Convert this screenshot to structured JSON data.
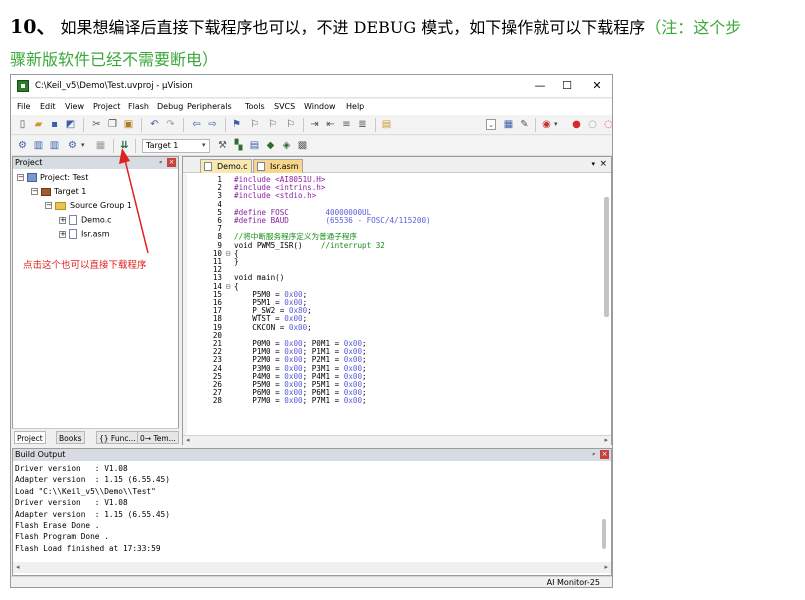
{
  "doc": {
    "step_number": "10、",
    "step_text": " 如果想编译后直接下载程序也可以，不进 DEBUG 模式，如下操作就可以下载程序",
    "note_part1": "（注：这个步",
    "note_part2": "骤新版软件已经不需要断电）"
  },
  "window": {
    "title": "C:\\Keil_v5\\Demo\\Test.uvproj - µVision",
    "min_symbol": "—",
    "max_symbol": "☐",
    "close_symbol": "✕",
    "menu": [
      "File",
      "Edit",
      "View",
      "Project",
      "Flash",
      "Debug",
      "Peripherals",
      "Tools",
      "SVCS",
      "Window",
      "Help"
    ],
    "target_select": "Target 1"
  },
  "project_panel": {
    "header": "Project",
    "pin": "ᴾ",
    "close": "×",
    "tree": [
      {
        "label": "Project: Test",
        "toggle": "−"
      },
      {
        "label": "Target 1",
        "toggle": "−"
      },
      {
        "label": "Source Group 1",
        "toggle": "−"
      },
      {
        "label": "Demo.c",
        "toggle": "+"
      },
      {
        "label": "Isr.asm",
        "toggle": "+"
      }
    ],
    "annotation": "点击这个也可以直接下载程序",
    "tabs": [
      "Project",
      "Books",
      "{} Func...",
      "0→ Tem..."
    ]
  },
  "editor": {
    "tabs": [
      "Demo.c",
      "Isr.asm"
    ],
    "lines": [
      {
        "n": "1",
        "f": "",
        "code": [
          [
            "pp",
            "#include <AI8051U.H>"
          ]
        ]
      },
      {
        "n": "2",
        "f": "",
        "code": [
          [
            "pp",
            "#include <intrins.h>"
          ]
        ]
      },
      {
        "n": "3",
        "f": "",
        "code": [
          [
            "pp",
            "#include <stdio.h>"
          ]
        ]
      },
      {
        "n": "4",
        "f": "",
        "code": [
          [
            "",
            ""
          ]
        ]
      },
      {
        "n": "5",
        "f": "",
        "code": [
          [
            "pp",
            "#define FOSC        "
          ],
          [
            "nm",
            "40000000UL"
          ]
        ]
      },
      {
        "n": "6",
        "f": "",
        "code": [
          [
            "pp",
            "#define BAUD        "
          ],
          [
            "nm",
            "(65536 - FOSC/4/115200)"
          ]
        ]
      },
      {
        "n": "7",
        "f": "",
        "code": [
          [
            "",
            ""
          ]
        ]
      },
      {
        "n": "8",
        "f": "",
        "code": [
          [
            "cm",
            "//将中断服务程序定义为普通子程序"
          ]
        ]
      },
      {
        "n": "9",
        "f": "",
        "code": [
          [
            "",
            "void PWM5_ISR()    "
          ],
          [
            "cm",
            "//interrupt 32"
          ]
        ]
      },
      {
        "n": "10",
        "f": "⊟",
        "code": [
          [
            "",
            "{"
          ]
        ]
      },
      {
        "n": "11",
        "f": "",
        "code": [
          [
            "",
            "}"
          ]
        ]
      },
      {
        "n": "12",
        "f": "",
        "code": [
          [
            "",
            ""
          ]
        ]
      },
      {
        "n": "13",
        "f": "",
        "code": [
          [
            "",
            "void main()"
          ]
        ]
      },
      {
        "n": "14",
        "f": "⊟",
        "code": [
          [
            "",
            "{"
          ]
        ]
      },
      {
        "n": "15",
        "f": "",
        "code": [
          [
            "",
            "    P5M0 = "
          ],
          [
            "nm",
            "0x00"
          ],
          [
            "",
            ";"
          ]
        ]
      },
      {
        "n": "16",
        "f": "",
        "code": [
          [
            "",
            "    P5M1 = "
          ],
          [
            "nm",
            "0x00"
          ],
          [
            "",
            ";"
          ]
        ]
      },
      {
        "n": "17",
        "f": "",
        "code": [
          [
            "",
            "    P_SW2 = "
          ],
          [
            "nm",
            "0x80"
          ],
          [
            "",
            ";"
          ]
        ]
      },
      {
        "n": "18",
        "f": "",
        "code": [
          [
            "",
            "    WTST = "
          ],
          [
            "nm",
            "0x00"
          ],
          [
            "",
            ";"
          ]
        ]
      },
      {
        "n": "19",
        "f": "",
        "code": [
          [
            "",
            "    CKCON = "
          ],
          [
            "nm",
            "0x00"
          ],
          [
            "",
            ";"
          ]
        ]
      },
      {
        "n": "20",
        "f": "",
        "code": [
          [
            "",
            ""
          ]
        ]
      },
      {
        "n": "21",
        "f": "",
        "code": [
          [
            "",
            "    P0M0 = "
          ],
          [
            "nm",
            "0x00"
          ],
          [
            "",
            "; P0M1 = "
          ],
          [
            "nm",
            "0x00"
          ],
          [
            "",
            ";"
          ]
        ]
      },
      {
        "n": "22",
        "f": "",
        "code": [
          [
            "",
            "    P1M0 = "
          ],
          [
            "nm",
            "0x00"
          ],
          [
            "",
            "; P1M1 = "
          ],
          [
            "nm",
            "0x00"
          ],
          [
            "",
            ";"
          ]
        ]
      },
      {
        "n": "23",
        "f": "",
        "code": [
          [
            "",
            "    P2M0 = "
          ],
          [
            "nm",
            "0x00"
          ],
          [
            "",
            "; P2M1 = "
          ],
          [
            "nm",
            "0x00"
          ],
          [
            "",
            ";"
          ]
        ]
      },
      {
        "n": "24",
        "f": "",
        "code": [
          [
            "",
            "    P3M0 = "
          ],
          [
            "nm",
            "0x00"
          ],
          [
            "",
            "; P3M1 = "
          ],
          [
            "nm",
            "0x00"
          ],
          [
            "",
            ";"
          ]
        ]
      },
      {
        "n": "25",
        "f": "",
        "code": [
          [
            "",
            "    P4M0 = "
          ],
          [
            "nm",
            "0x00"
          ],
          [
            "",
            "; P4M1 = "
          ],
          [
            "nm",
            "0x00"
          ],
          [
            "",
            ";"
          ]
        ]
      },
      {
        "n": "26",
        "f": "",
        "code": [
          [
            "",
            "    P5M0 = "
          ],
          [
            "nm",
            "0x00"
          ],
          [
            "",
            "; P5M1 = "
          ],
          [
            "nm",
            "0x00"
          ],
          [
            "",
            ";"
          ]
        ]
      },
      {
        "n": "27",
        "f": "",
        "code": [
          [
            "",
            "    P6M0 = "
          ],
          [
            "nm",
            "0x00"
          ],
          [
            "",
            "; P6M1 = "
          ],
          [
            "nm",
            "0x00"
          ],
          [
            "",
            ";"
          ]
        ]
      },
      {
        "n": "28",
        "f": "",
        "code": [
          [
            "",
            "    P7M0 = "
          ],
          [
            "nm",
            "0x00"
          ],
          [
            "",
            "; P7M1 = "
          ],
          [
            "nm",
            "0x00"
          ],
          [
            "",
            ";"
          ]
        ]
      }
    ]
  },
  "build_output": {
    "header": "Build Output",
    "pin": "ᴾ",
    "close": "×",
    "lines": [
      "Driver version   : V1.08",
      "Adapter version  : 1.15 (6.55.45)",
      "Load \"C:\\\\Keil_v5\\\\Demo\\\\Test\"",
      "Driver version   : V1.08",
      "Adapter version  : 1.15 (6.55.45)",
      "Flash Erase Done .",
      "Flash Program Done .",
      "Flash Load finished at 17:33:59"
    ]
  },
  "status_bar": {
    "right": "AI Monitor-25"
  },
  "colors": {
    "annotation": "#e02020",
    "note": "#3aa83a"
  }
}
